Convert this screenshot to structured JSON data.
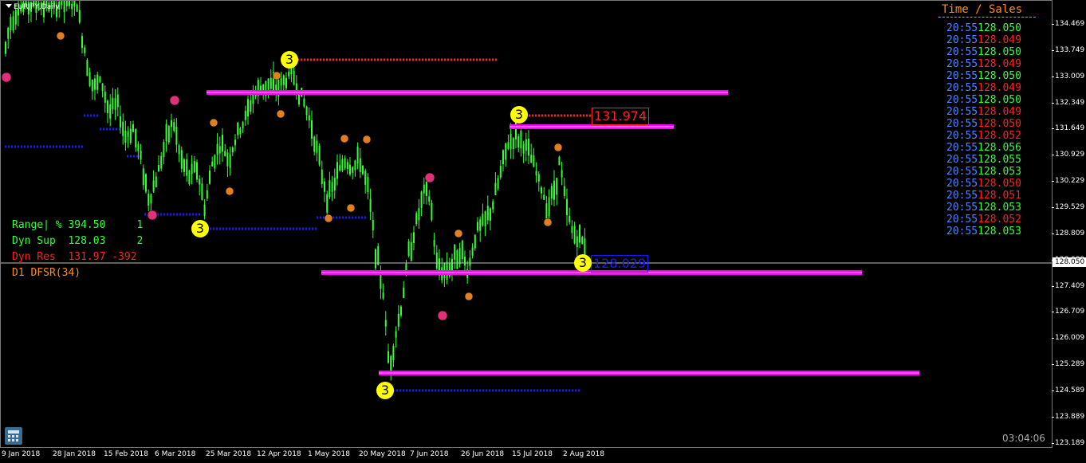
{
  "symbol": "EURJPY,Daily",
  "colors": {
    "background": "#000000",
    "candle": "#33ff33",
    "zone_line": "#ff00ff",
    "support_dots": "#1a1aff",
    "resistance_dots": "#ff2020",
    "badge": "#ffff00",
    "fractal_orange": "#e08020",
    "fractal_pink": "#e0307a",
    "sell_price": "#ff2020",
    "buy_price": "#33ff33",
    "time": "#4d86ff",
    "title_orange": "#ff8c1a"
  },
  "y_axis": {
    "ticks": [
      "134.469",
      "133.749",
      "133.009",
      "132.349",
      "131.649",
      "130.929",
      "130.229",
      "129.529",
      "128.809",
      "128.089",
      "127.409",
      "126.709",
      "126.009",
      "125.289",
      "124.589",
      "123.889",
      "123.189"
    ],
    "current_price": "128.050"
  },
  "x_axis": {
    "ticks": [
      "9 Jan 2018",
      "28 Jan 2018",
      "15 Feb 2018",
      "6 Mar 2018",
      "25 Mar 2018",
      "12 Apr 2018",
      "1 May 2018",
      "20 May 2018",
      "7 Jun 2018",
      "26 Jun 2018",
      "15 Jul 2018",
      "2 Aug 2018"
    ]
  },
  "time_sales": {
    "title": "Time / Sales",
    "rows": [
      {
        "time": "20:55",
        "price": "128.050",
        "dir": "up"
      },
      {
        "time": "20:55",
        "price": "128.049",
        "dir": "down"
      },
      {
        "time": "20:55",
        "price": "128.050",
        "dir": "up"
      },
      {
        "time": "20:55",
        "price": "128.049",
        "dir": "down"
      },
      {
        "time": "20:55",
        "price": "128.050",
        "dir": "up"
      },
      {
        "time": "20:55",
        "price": "128.049",
        "dir": "down"
      },
      {
        "time": "20:55",
        "price": "128.050",
        "dir": "up"
      },
      {
        "time": "20:55",
        "price": "128.049",
        "dir": "down"
      },
      {
        "time": "20:55",
        "price": "128.050",
        "dir": "down"
      },
      {
        "time": "20:55",
        "price": "128.052",
        "dir": "down"
      },
      {
        "time": "20:55",
        "price": "128.056",
        "dir": "up"
      },
      {
        "time": "20:55",
        "price": "128.055",
        "dir": "up"
      },
      {
        "time": "20:55",
        "price": "128.053",
        "dir": "up"
      },
      {
        "time": "20:55",
        "price": "128.050",
        "dir": "down"
      },
      {
        "time": "20:55",
        "price": "128.051",
        "dir": "down"
      },
      {
        "time": "20:55",
        "price": "128.053",
        "dir": "up"
      },
      {
        "time": "20:55",
        "price": "128.052",
        "dir": "down"
      },
      {
        "time": "20:55",
        "price": "128.053",
        "dir": "up"
      }
    ]
  },
  "info_panel": {
    "range": "Range| % 394.50     1",
    "dyn_sup": "Dyn Sup  128.03     2",
    "dyn_res": "Dyn Res  131.97 -392",
    "indicator": "D1 DFSR(34)"
  },
  "price_labels": {
    "resistance": "131.974",
    "support": "128.029"
  },
  "badges": {
    "label": "3"
  },
  "timer": "03:04:06"
}
